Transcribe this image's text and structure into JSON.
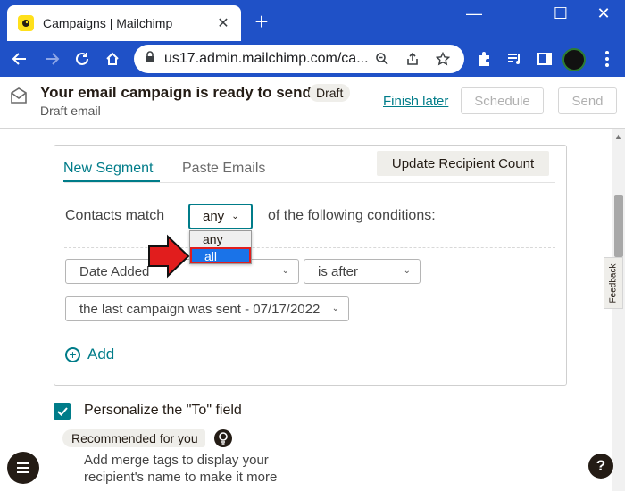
{
  "browser": {
    "tab_title": "Campaigns | Mailchimp",
    "tab_close": "✕",
    "new_tab": "+",
    "window": {
      "minimize": "—",
      "maximize": "☐",
      "close": "✕"
    },
    "url": "us17.admin.mailchimp.com/ca..."
  },
  "header": {
    "title": "Your email campaign is ready to send!",
    "status_badge": "Draft",
    "subtitle": "Draft email",
    "finish_later": "Finish later",
    "schedule": "Schedule",
    "send": "Send"
  },
  "segment": {
    "tabs": [
      {
        "label": "New Segment",
        "active": true
      },
      {
        "label": "Paste Emails",
        "active": false
      }
    ],
    "update_button": "Update Recipient Count",
    "contacts_match": "Contacts match",
    "match_value": "any",
    "of_following": "of the following conditions:",
    "match_options": [
      "any",
      "all"
    ],
    "highlighted_option": "all",
    "condition_field": "Date Added",
    "condition_operator": "is after",
    "condition_value": "the last campaign was sent - 07/17/2022",
    "add_label": "Add"
  },
  "personalize": {
    "checked": true,
    "label": "Personalize the \"To\" field",
    "recommended": "Recommended for you",
    "helper_text": "Add merge tags to display your recipient's name to make it more"
  },
  "feedback_label": "Feedback",
  "help_label": "?",
  "colors": {
    "chrome": "#1f51c7",
    "teal": "#007c89",
    "highlight": "#1a73e8",
    "arrow": "#e11d1d"
  }
}
